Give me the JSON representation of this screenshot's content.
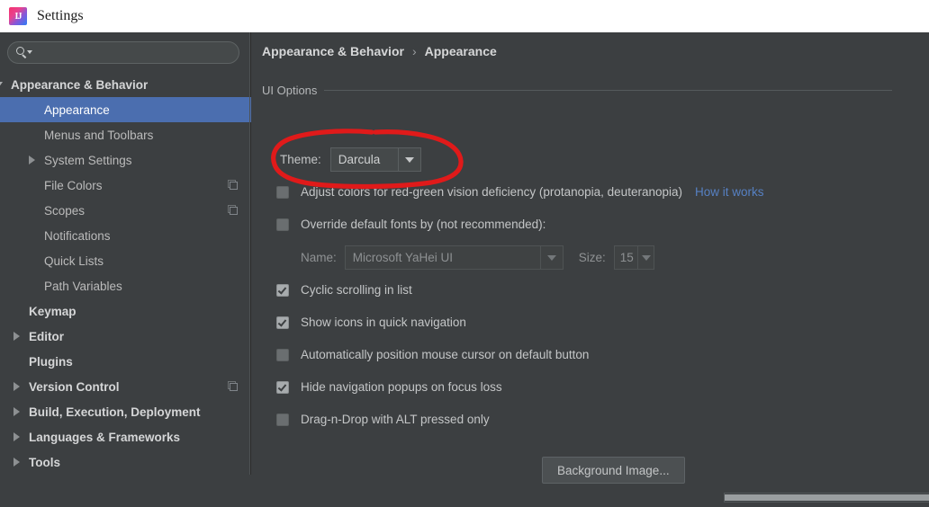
{
  "window": {
    "title": "Settings",
    "app_icon": "intellij-idea-icon"
  },
  "sidebar": {
    "search": {
      "placeholder": "",
      "value": "",
      "icon": "search-icon"
    },
    "items": [
      {
        "label": "Appearance & Behavior",
        "indent": 12,
        "twisty": "down",
        "bold": true,
        "selected": false,
        "side_icon": false
      },
      {
        "label": "Appearance",
        "indent": 49,
        "twisty": "none",
        "bold": false,
        "selected": true,
        "side_icon": false
      },
      {
        "label": "Menus and Toolbars",
        "indent": 49,
        "twisty": "none",
        "bold": false,
        "selected": false,
        "side_icon": false
      },
      {
        "label": "System Settings",
        "indent": 49,
        "twisty": "right",
        "bold": false,
        "selected": false,
        "side_icon": false
      },
      {
        "label": "File Colors",
        "indent": 49,
        "twisty": "none",
        "bold": false,
        "selected": false,
        "side_icon": true
      },
      {
        "label": "Scopes",
        "indent": 49,
        "twisty": "none",
        "bold": false,
        "selected": false,
        "side_icon": true
      },
      {
        "label": "Notifications",
        "indent": 49,
        "twisty": "none",
        "bold": false,
        "selected": false,
        "side_icon": false
      },
      {
        "label": "Quick Lists",
        "indent": 49,
        "twisty": "none",
        "bold": false,
        "selected": false,
        "side_icon": false
      },
      {
        "label": "Path Variables",
        "indent": 49,
        "twisty": "none",
        "bold": false,
        "selected": false,
        "side_icon": false
      },
      {
        "label": "Keymap",
        "indent": 32,
        "twisty": "none",
        "bold": true,
        "selected": false,
        "side_icon": false
      },
      {
        "label": "Editor",
        "indent": 32,
        "twisty": "right",
        "bold": true,
        "selected": false,
        "side_icon": false
      },
      {
        "label": "Plugins",
        "indent": 32,
        "twisty": "none",
        "bold": true,
        "selected": false,
        "side_icon": false
      },
      {
        "label": "Version Control",
        "indent": 32,
        "twisty": "right",
        "bold": true,
        "selected": false,
        "side_icon": true
      },
      {
        "label": "Build, Execution, Deployment",
        "indent": 32,
        "twisty": "right",
        "bold": true,
        "selected": false,
        "side_icon": false
      },
      {
        "label": "Languages & Frameworks",
        "indent": 32,
        "twisty": "right",
        "bold": true,
        "selected": false,
        "side_icon": false
      },
      {
        "label": "Tools",
        "indent": 32,
        "twisty": "right",
        "bold": true,
        "selected": false,
        "side_icon": false
      }
    ]
  },
  "content": {
    "breadcrumb": {
      "root": "Appearance & Behavior",
      "separator": "›",
      "leaf": "Appearance"
    },
    "group_title": "UI Options",
    "theme": {
      "label": "Theme:",
      "value": "Darcula",
      "arrow_icon": "chevron-down-icon"
    },
    "checkboxes": [
      {
        "label": "Adjust colors for red-green vision deficiency (protanopia, deuteranopia)",
        "checked": false,
        "link": "How it works"
      },
      {
        "label": "Override default fonts by (not recommended):",
        "checked": false,
        "link": ""
      },
      {
        "label": "Cyclic scrolling in list",
        "checked": true,
        "link": ""
      },
      {
        "label": "Show icons in quick navigation",
        "checked": true,
        "link": ""
      },
      {
        "label": "Automatically position mouse cursor on default button",
        "checked": false,
        "link": ""
      },
      {
        "label": "Hide navigation popups on focus loss",
        "checked": true,
        "link": ""
      },
      {
        "label": "Drag-n-Drop with ALT pressed only",
        "checked": false,
        "link": ""
      }
    ],
    "font_row": {
      "name_label": "Name:",
      "name_value": "Microsoft YaHei UI",
      "size_label": "Size:",
      "size_value": "15"
    },
    "background_image_button": "Background Image...",
    "scrollbar": {
      "orientation": "horizontal"
    }
  },
  "annotation": {
    "shape": "hand-drawn-ellipse",
    "color": "#e01a1a",
    "targets": "theme-dropdown"
  },
  "colors": {
    "window_bg": "#3c3f41",
    "selection": "#4b6eaf",
    "link": "#5680c2",
    "annotation_red": "#e01a1a",
    "titlebar_bg": "#ffffff"
  }
}
